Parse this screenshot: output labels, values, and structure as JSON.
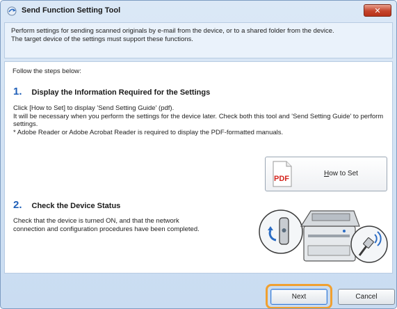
{
  "window": {
    "title": "Send Function Setting Tool",
    "close_label": "✕"
  },
  "header": {
    "line1": "Perform settings for sending scanned originals by e-mail from the device, or to a shared folder from the device.",
    "line2": "The target device of the settings must support these functions."
  },
  "body": {
    "follow_steps": "Follow the steps below:",
    "step1": {
      "number": "1.",
      "title": "Display the Information Required for the Settings",
      "desc_line1": "Click [How to Set] to display 'Send Setting Guide' (pdf).",
      "desc_line2": "It will be necessary when you perform the settings for the device later. Check both this tool and 'Send Setting Guide' to perform settings.",
      "desc_line3": "* Adobe Reader or Adobe Acrobat Reader is required to display the PDF-formatted manuals."
    },
    "how_to_set": {
      "icon_label": "PDF",
      "label_first": "H",
      "label_rest": "ow to Set"
    },
    "step2": {
      "number": "2.",
      "title": "Check the Device Status",
      "desc": "Check that the device is turned ON, and that the network connection and configuration procedures have been completed."
    }
  },
  "footer": {
    "next_label": "Next",
    "cancel_label": "Cancel"
  },
  "icons": {
    "title": "app-icon",
    "pdf": "pdf-file-icon",
    "device": "multifunction-printer-illustration"
  },
  "colors": {
    "step_number": "#1f5fb8",
    "close_button": "#c4442b",
    "highlight": "#f0a030"
  }
}
